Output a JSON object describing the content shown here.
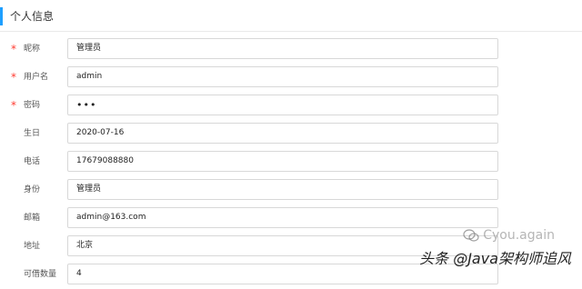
{
  "section": {
    "title": "个人信息"
  },
  "required_marker": "*",
  "form": {
    "rows": [
      {
        "label": "昵称",
        "value": "管理员",
        "required": true
      },
      {
        "label": "用户名",
        "value": "admin",
        "required": true
      },
      {
        "label": "密码",
        "value": "•••",
        "required": true
      },
      {
        "label": "生日",
        "value": "2020-07-16",
        "required": false
      },
      {
        "label": "电话",
        "value": "17679088880",
        "required": false
      },
      {
        "label": "身份",
        "value": "管理员",
        "required": false
      },
      {
        "label": "邮箱",
        "value": "admin@163.com",
        "required": false
      },
      {
        "label": "地址",
        "value": "北京",
        "required": false
      },
      {
        "label": "可借数量",
        "value": "4",
        "required": false
      }
    ]
  },
  "watermark": {
    "handle": "Cyou.again",
    "title": "头条 @Java架构师追风"
  }
}
